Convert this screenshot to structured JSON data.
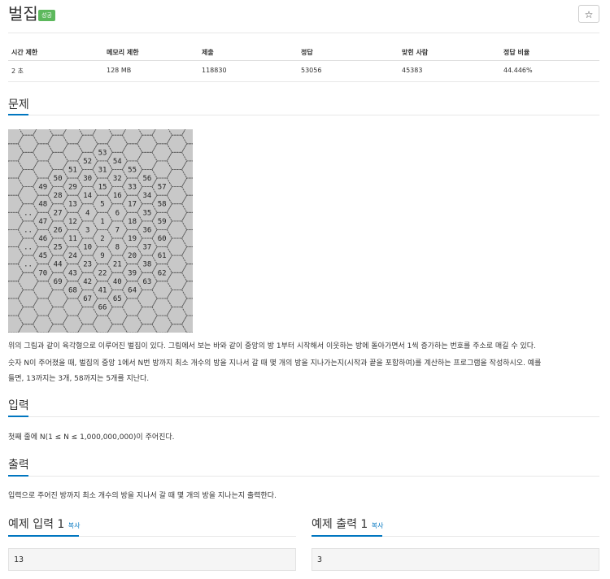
{
  "header": {
    "title": "벌집",
    "badge": "성공",
    "star": "☆"
  },
  "stats": {
    "headers": [
      "시간 제한",
      "메모리 제한",
      "제출",
      "정답",
      "맞힌 사람",
      "정답 비율"
    ],
    "values": [
      "2 초",
      "128 MB",
      "118830",
      "53056",
      "45383",
      "44.446%"
    ]
  },
  "problem": {
    "heading": "문제",
    "description_lines": [
      "위의 그림과 같이 육각형으로 이루어진 벌집이 있다. 그림에서 보는 바와 같이 중앙의 방 1부터 시작해서 이웃하는 방에 돌아가면서 1씩 증가하는 번호를 주소로 매길 수 있다.",
      "숫자 N이 주어졌을 때, 벌집의 중앙 1에서 N번 방까지 최소 개수의 방을 지나서 갈 때 몇 개의 방을 지나가는지(시작과 끝을 포함하여)를 계산하는 프로그램을 작성하시오. 예를",
      "들면, 13까지는 3개, 58까지는 5개를 지난다."
    ]
  },
  "input": {
    "heading": "입력",
    "text": "첫째 줄에 N(1 ≤ N ≤ 1,000,000,000)이 주어진다."
  },
  "output": {
    "heading": "출력",
    "text": "입력으로 주어진 방까지 최소 개수의 방을 지나서 갈 때 몇 개의 방을 지나는지 출력한다."
  },
  "samples": {
    "input_heading": "예제 입력 1",
    "output_heading": "예제 출력 1",
    "copy_label": "복사",
    "input_value": "13",
    "output_value": "3"
  },
  "honeycomb": {
    "cells": [
      {
        "label": "53",
        "q": 0,
        "r": -5
      },
      {
        "label": "52",
        "q": -1,
        "r": -4
      },
      {
        "label": "54",
        "q": 1,
        "r": -5
      },
      {
        "label": "51",
        "q": -2,
        "r": -3
      },
      {
        "label": "31",
        "q": 0,
        "r": -4
      },
      {
        "label": "55",
        "q": 2,
        "r": -5
      },
      {
        "label": "50",
        "q": -3,
        "r": -2
      },
      {
        "label": "30",
        "q": -1,
        "r": -3
      },
      {
        "label": "32",
        "q": 1,
        "r": -4
      },
      {
        "label": "56",
        "q": 3,
        "r": -5
      },
      {
        "label": "49",
        "q": -4,
        "r": -1
      },
      {
        "label": "29",
        "q": -2,
        "r": -2
      },
      {
        "label": "15",
        "q": 0,
        "r": -3
      },
      {
        "label": "33",
        "q": 2,
        "r": -4
      },
      {
        "label": "57",
        "q": 4,
        "r": -5
      },
      {
        "label": "28",
        "q": -3,
        "r": -1
      },
      {
        "label": "14",
        "q": -1,
        "r": -2
      },
      {
        "label": "16",
        "q": 1,
        "r": -3
      },
      {
        "label": "34",
        "q": 3,
        "r": -4
      },
      {
        "label": "48",
        "q": -4,
        "r": 0
      },
      {
        "label": "13",
        "q": -2,
        "r": -1
      },
      {
        "label": "5",
        "q": 0,
        "r": -2
      },
      {
        "label": "17",
        "q": 2,
        "r": -3
      },
      {
        "label": "58",
        "q": 4,
        "r": -4
      },
      {
        "label": "..",
        "q": -5,
        "r": 1
      },
      {
        "label": "27",
        "q": -3,
        "r": 0
      },
      {
        "label": "4",
        "q": -1,
        "r": -1
      },
      {
        "label": "6",
        "q": 1,
        "r": -2
      },
      {
        "label": "35",
        "q": 3,
        "r": -3
      },
      {
        "label": "47",
        "q": -4,
        "r": 1
      },
      {
        "label": "12",
        "q": -2,
        "r": 0
      },
      {
        "label": "1",
        "q": 0,
        "r": -1
      },
      {
        "label": "18",
        "q": 2,
        "r": -2
      },
      {
        "label": "59",
        "q": 4,
        "r": -3
      },
      {
        "label": "..",
        "q": -5,
        "r": 2
      },
      {
        "label": "26",
        "q": -3,
        "r": 1
      },
      {
        "label": "3",
        "q": -1,
        "r": 0
      },
      {
        "label": "7",
        "q": 1,
        "r": -1
      },
      {
        "label": "36",
        "q": 3,
        "r": -2
      },
      {
        "label": "46",
        "q": -4,
        "r": 2
      },
      {
        "label": "11",
        "q": -2,
        "r": 1
      },
      {
        "label": "2",
        "q": 0,
        "r": 0
      },
      {
        "label": "19",
        "q": 2,
        "r": -1
      },
      {
        "label": "60",
        "q": 4,
        "r": -2
      },
      {
        "label": "..",
        "q": -5,
        "r": 3
      },
      {
        "label": "25",
        "q": -3,
        "r": 2
      },
      {
        "label": "10",
        "q": -1,
        "r": 1
      },
      {
        "label": "8",
        "q": 1,
        "r": 0
      },
      {
        "label": "37",
        "q": 3,
        "r": -1
      },
      {
        "label": "45",
        "q": -4,
        "r": 3
      },
      {
        "label": "24",
        "q": -2,
        "r": 2
      },
      {
        "label": "9",
        "q": 0,
        "r": 1
      },
      {
        "label": "20",
        "q": 2,
        "r": 0
      },
      {
        "label": "61",
        "q": 4,
        "r": -1
      },
      {
        "label": "..",
        "q": -5,
        "r": 4
      },
      {
        "label": "44",
        "q": -3,
        "r": 3
      },
      {
        "label": "23",
        "q": -1,
        "r": 2
      },
      {
        "label": "21",
        "q": 1,
        "r": 1
      },
      {
        "label": "38",
        "q": 3,
        "r": 0
      },
      {
        "label": "70",
        "q": -4,
        "r": 4
      },
      {
        "label": "43",
        "q": -2,
        "r": 3
      },
      {
        "label": "22",
        "q": 0,
        "r": 2
      },
      {
        "label": "39",
        "q": 2,
        "r": 1
      },
      {
        "label": "62",
        "q": 4,
        "r": 0
      },
      {
        "label": "69",
        "q": -3,
        "r": 4
      },
      {
        "label": "42",
        "q": -1,
        "r": 3
      },
      {
        "label": "40",
        "q": 1,
        "r": 2
      },
      {
        "label": "63",
        "q": 3,
        "r": 1
      },
      {
        "label": "68",
        "q": -2,
        "r": 4
      },
      {
        "label": "41",
        "q": 0,
        "r": 3
      },
      {
        "label": "64",
        "q": 2,
        "r": 2
      },
      {
        "label": "67",
        "q": -1,
        "r": 4
      },
      {
        "label": "65",
        "q": 1,
        "r": 3
      },
      {
        "label": "66",
        "q": 0,
        "r": 4
      }
    ]
  }
}
